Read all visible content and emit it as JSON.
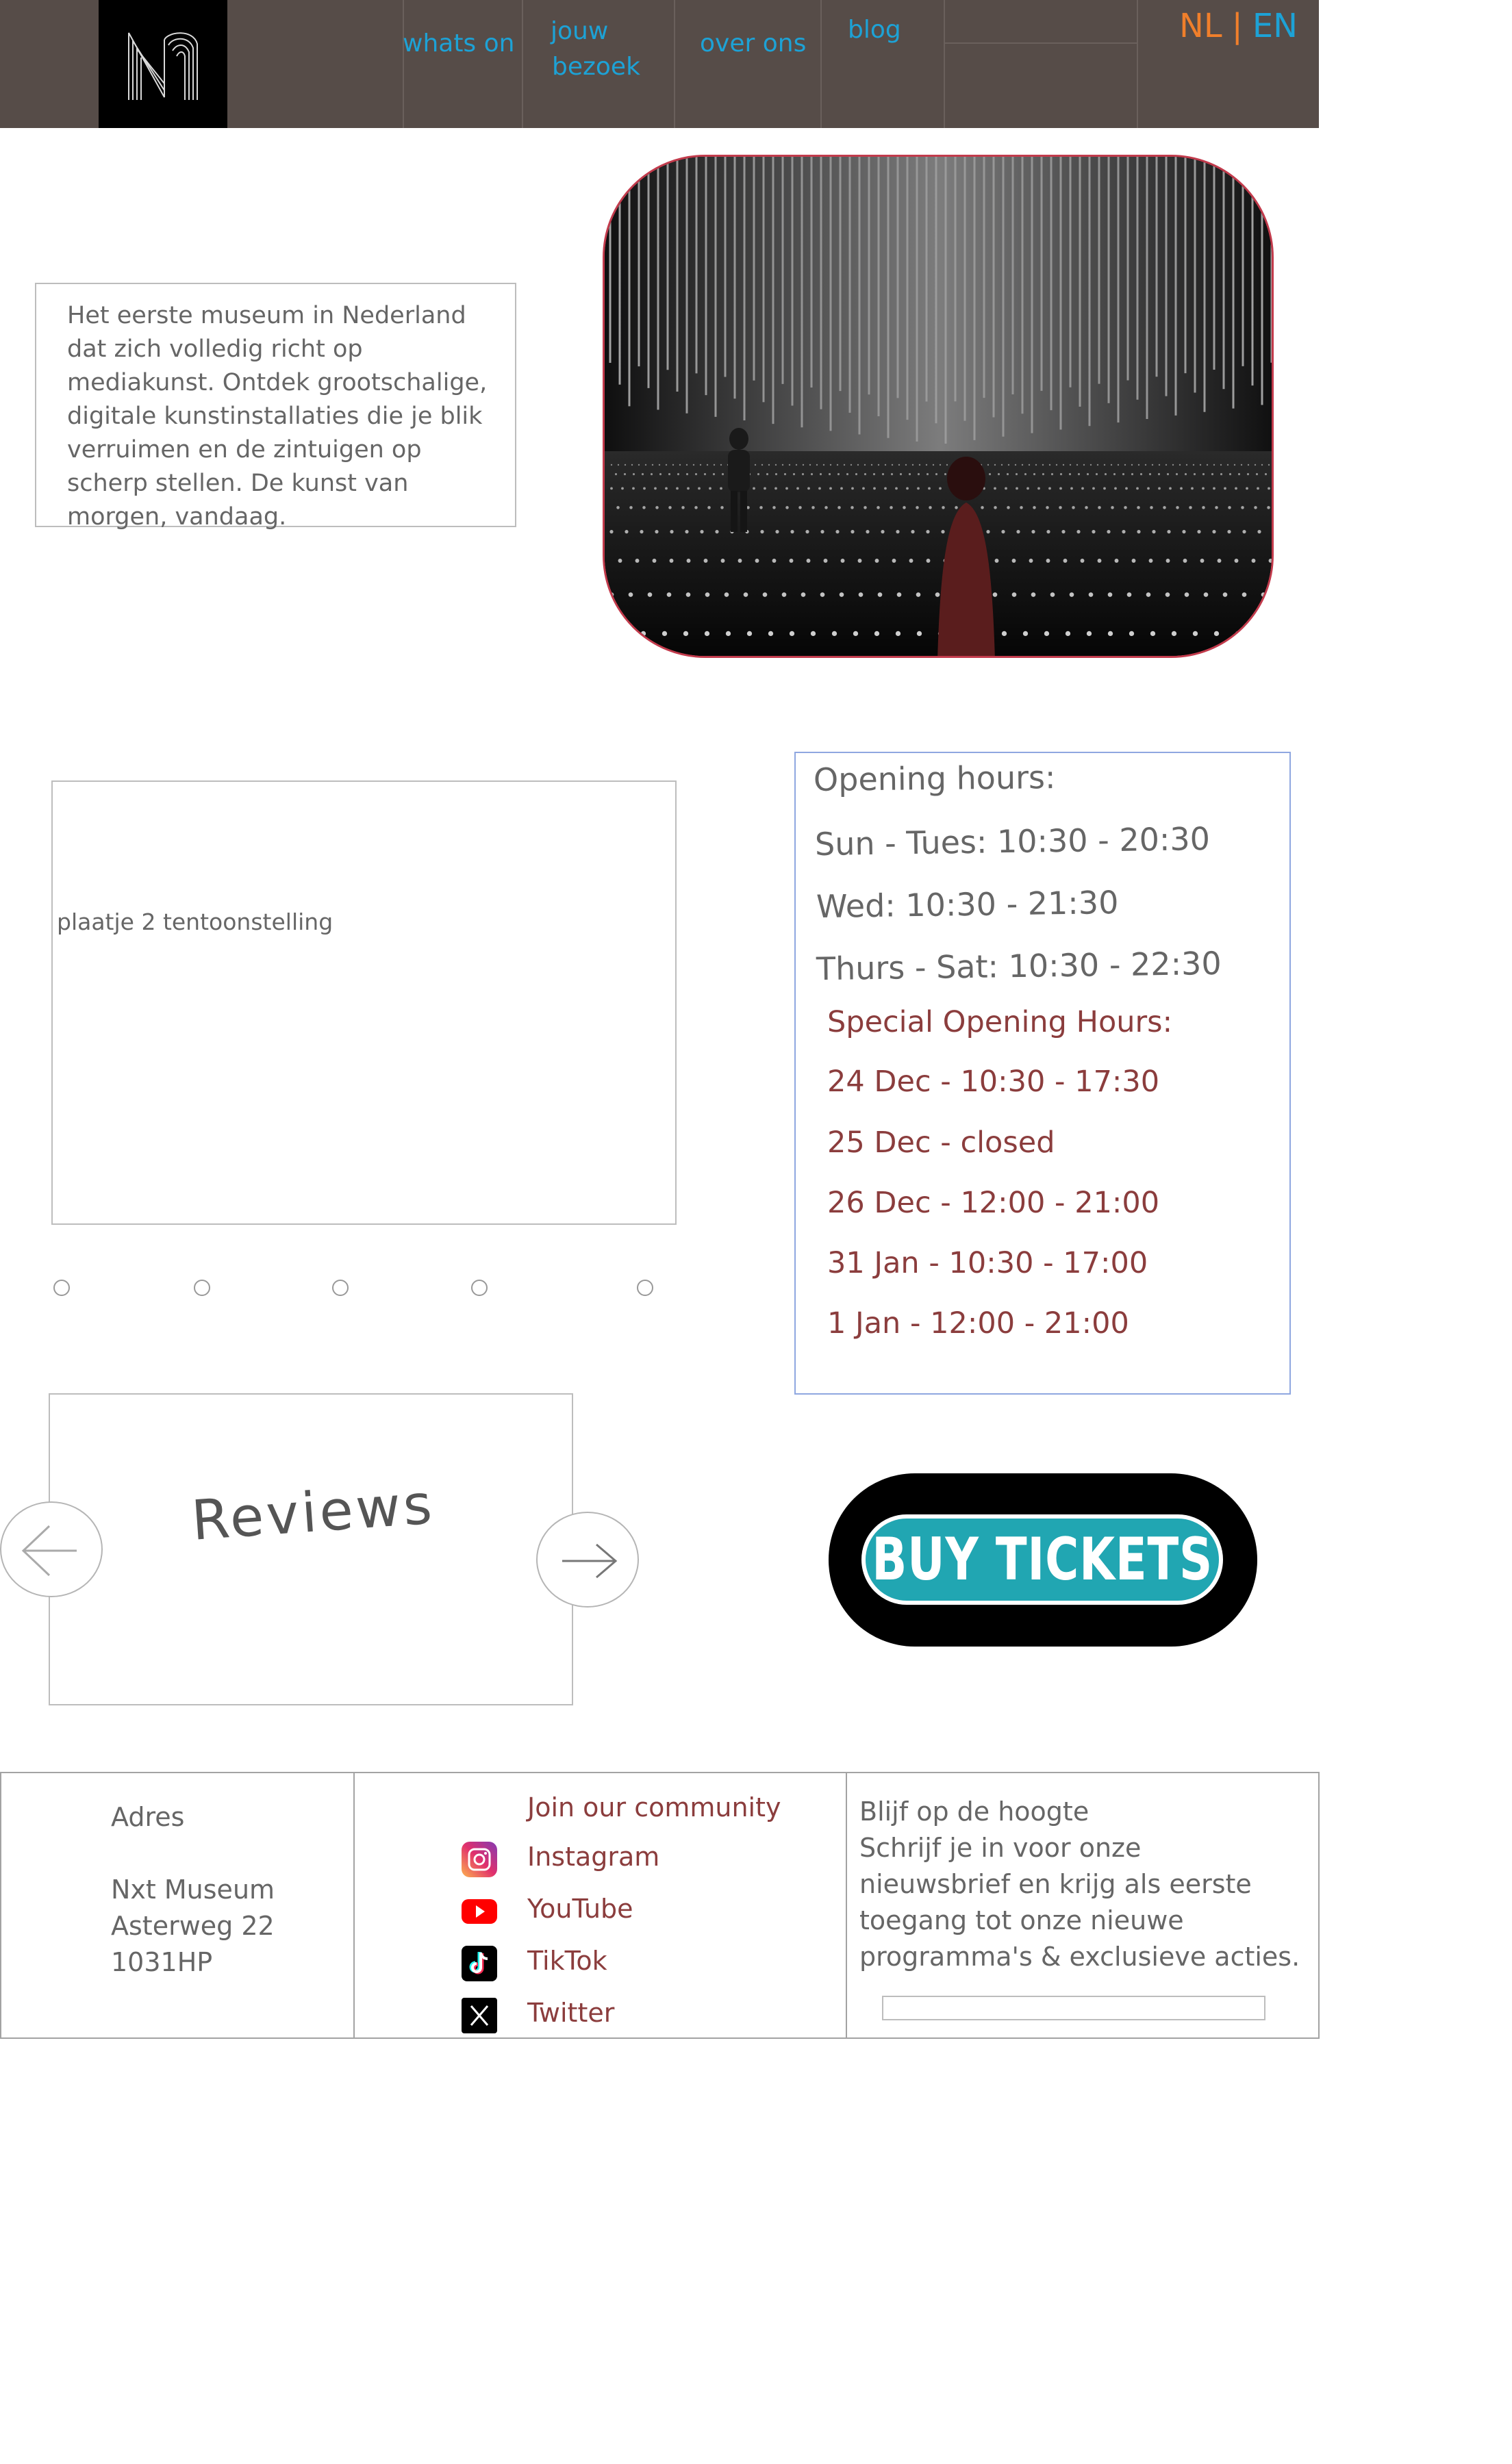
{
  "nav": {
    "items": [
      {
        "label": "whats on"
      },
      {
        "label": "jouw"
      },
      {
        "label": "bezoek"
      },
      {
        "label": "over ons"
      },
      {
        "label": "blog"
      }
    ],
    "lang": {
      "nl": "NL",
      "separator": "|",
      "en": "EN"
    }
  },
  "intro": {
    "text": "Het eerste museum in Nederland dat zich volledig richt op mediakunst. Ontdek grootschalige, digitale kunstinstallaties die je blik verruimen en de zintuigen op scherp stellen. De kunst van morgen, vandaag."
  },
  "exhibition": {
    "placeholder": "plaatje 2 tentoonstelling",
    "dots": 5
  },
  "hours": {
    "title": "Opening hours:",
    "regular": [
      "Sun - Tues: 10:30 - 20:30",
      "Wed: 10:30 - 21:30",
      "Thurs - Sat: 10:30 - 22:30"
    ],
    "special_title": "Special Opening Hours:",
    "special": [
      "24 Dec - 10:30 - 17:30",
      "25 Dec - closed",
      "26 Dec - 12:00 - 21:00",
      "31 Jan - 10:30 - 17:00",
      "1 Jan - 12:00 - 21:00"
    ]
  },
  "reviews": {
    "title": "Reviews"
  },
  "tickets": {
    "label": "BUY TICKETS"
  },
  "footer": {
    "address": {
      "heading": "Adres",
      "line1": "Nxt Museum",
      "line2": "Asterweg 22",
      "line3": "1031HP"
    },
    "community": {
      "heading": "Join our community",
      "links": [
        {
          "label": "Instagram",
          "icon": "instagram-icon"
        },
        {
          "label": "YouTube",
          "icon": "youtube-icon"
        },
        {
          "label": "TikTok",
          "icon": "tiktok-icon"
        },
        {
          "label": "Twitter",
          "icon": "x-twitter-icon"
        }
      ]
    },
    "newsletter": {
      "line1": "Blijf op de hoogte",
      "line2": "Schrijf je in voor onze",
      "line3": "nieuwsbrief en krijg als eerste",
      "line4": "toegang tot onze nieuwe",
      "line5": "programma's & exclusieve acties."
    }
  },
  "colors": {
    "nav_bg": "#564c48",
    "nav_link": "#1da2d6",
    "lang_active": "#f07f2b",
    "accent_red": "#8b3d3d",
    "ticket_teal": "#21a6b2"
  }
}
